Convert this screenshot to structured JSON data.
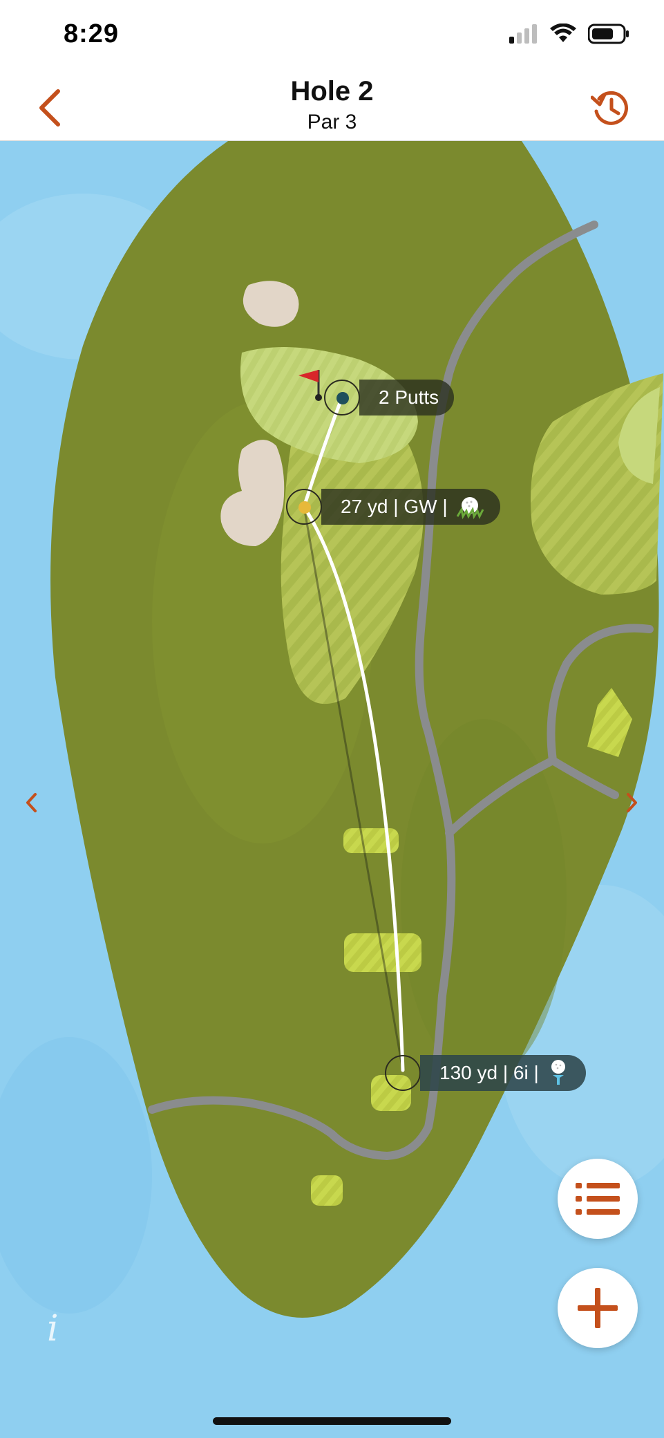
{
  "status_bar": {
    "time": "8:29",
    "icons": [
      "cellular-signal-icon",
      "wifi-icon",
      "battery-icon"
    ]
  },
  "nav": {
    "title": "Hole 2",
    "subtitle": "Par 3",
    "back_icon": "chevron-left-icon",
    "history_icon": "history-icon"
  },
  "shots": [
    {
      "text": "2 Putts",
      "type": "putts"
    },
    {
      "text": "27 yd | GW |",
      "type": "approach",
      "lie_icon": "ball-in-rough-icon"
    },
    {
      "text": "130 yd | 6i |",
      "type": "tee",
      "lie_icon": "ball-on-tee-icon"
    }
  ],
  "actions": {
    "list_icon": "list-icon",
    "add_icon": "plus-icon",
    "info_icon": "info-icon",
    "info_text": "i"
  },
  "colors": {
    "accent": "#C4501C",
    "water": "#8FCFF0",
    "rough": "#7B8A2E",
    "fairway": "#B6C457",
    "green": "#C6D87C",
    "bunker": "#E2D6C8",
    "cart_path": "#8A8C8E",
    "approach_dot": "#E7B93A",
    "pin_dot": "#1F4F5C",
    "flag": "#D8262A"
  }
}
